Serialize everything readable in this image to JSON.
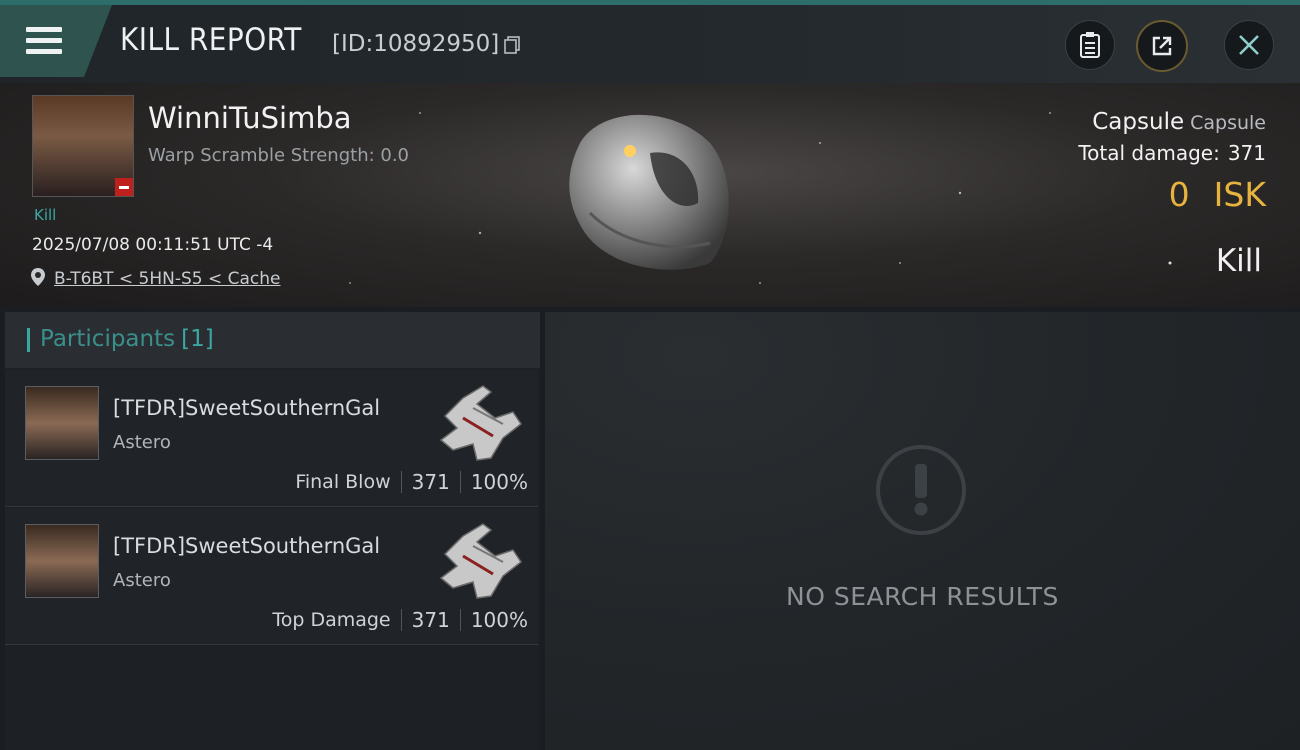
{
  "header": {
    "title": "KILL REPORT",
    "report_id": "[ID:10892950]",
    "icons": [
      "menu-icon",
      "copy-icon",
      "clipboard-icon",
      "share-icon",
      "close-icon"
    ]
  },
  "victim": {
    "name": "WinniTuSimba",
    "warp_scramble": "Warp Scramble Strength: 0.0",
    "tag": "Kill",
    "datetime": "2025/07/08 00:11:51 UTC -4",
    "location": "B-T6BT < 5HN-S5 < Cache",
    "ship_name": "Capsule",
    "ship_class": "Capsule",
    "total_damage_label": "Total damage:",
    "total_damage": "371",
    "isk_value": "0",
    "isk_label": "ISK",
    "result": "Kill"
  },
  "participants": {
    "label": "Participants",
    "count": "[1]",
    "rows": [
      {
        "name": "[TFDR]SweetSouthernGal",
        "ship": "Astero",
        "role": "Final Blow",
        "damage": "371",
        "percent": "100%"
      },
      {
        "name": "[TFDR]SweetSouthernGal",
        "ship": "Astero",
        "role": "Top Damage",
        "damage": "371",
        "percent": "100%"
      }
    ]
  },
  "details": {
    "empty_text": "NO SEARCH RESULTS"
  },
  "colors": {
    "accent": "#3ba7a1",
    "isk": "#e6b33e",
    "danger": "#c0201c"
  }
}
